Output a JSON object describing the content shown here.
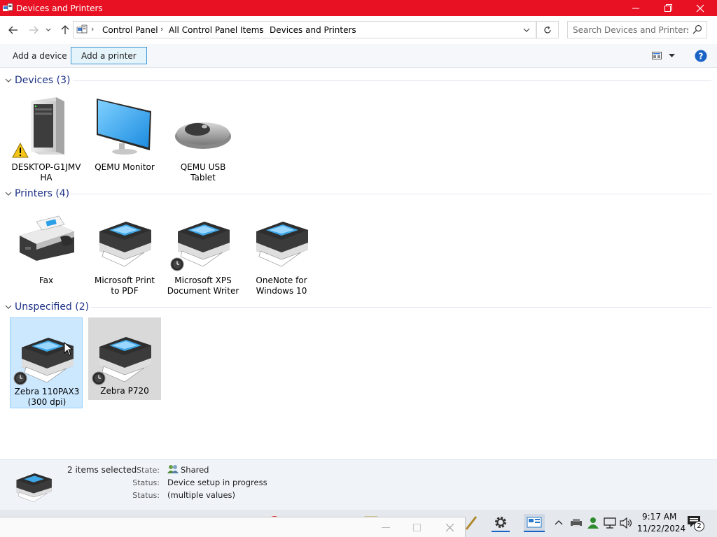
{
  "window": {
    "title": "Devices and Printers",
    "controls": [
      "minimize",
      "restore",
      "close"
    ]
  },
  "address_bar": {
    "breadcrumbs": [
      "Control Panel",
      "All Control Panel Items",
      "Devices and Printers"
    ],
    "search_placeholder": "Search Devices and Printers"
  },
  "command_bar": {
    "add_device": "Add a device",
    "add_printer": "Add a printer"
  },
  "groups": {
    "devices": {
      "label": "Devices (3)",
      "items": [
        {
          "name": "DESKTOP-G1JMV HA",
          "line1": "DESKTOP-G1JMV",
          "line2": "HA",
          "icon": "computer-icon",
          "badge": "warning-icon"
        },
        {
          "name": "QEMU Monitor",
          "line1": "QEMU Monitor",
          "line2": "",
          "icon": "monitor-icon"
        },
        {
          "name": "QEMU USB Tablet",
          "line1": "QEMU USB Tablet",
          "line2": "",
          "icon": "mouse-icon"
        }
      ]
    },
    "printers": {
      "label": "Printers (4)",
      "items": [
        {
          "line1": "Fax",
          "line2": "",
          "icon": "fax-icon"
        },
        {
          "line1": "Microsoft Print",
          "line2": "to PDF",
          "icon": "printer-icon"
        },
        {
          "line1": "Microsoft XPS",
          "line2": "Document Writer",
          "icon": "printer-icon",
          "badge": "clock-icon"
        },
        {
          "line1": "OneNote for",
          "line2": "Windows 10",
          "icon": "printer-icon"
        }
      ]
    },
    "unspecified": {
      "label": "Unspecified (2)",
      "items": [
        {
          "line1": "Zebra 110PAX3",
          "line2": "(300 dpi)",
          "icon": "printer-icon",
          "badge": "clock-icon",
          "state": "selected"
        },
        {
          "line1": "Zebra P720",
          "line2": "",
          "icon": "printer-icon",
          "badge": "clock-icon",
          "state": "hovered"
        }
      ]
    }
  },
  "details": {
    "selection": "2 items selected",
    "state_label": "State:",
    "state_value": "Shared",
    "status_label": "Status:",
    "status_value": "Device setup in progress",
    "status2_label": "Status:",
    "status2_value": "(multiple values)"
  },
  "taskbar": {
    "time": "9:17 AM",
    "date": "11/22/2024",
    "notification_count": "2"
  },
  "colors": {
    "titlebar": "#e81123",
    "selected_bg": "#cce8ff",
    "hover_bg": "#d9d9d9",
    "group_label": "#1e3287"
  }
}
